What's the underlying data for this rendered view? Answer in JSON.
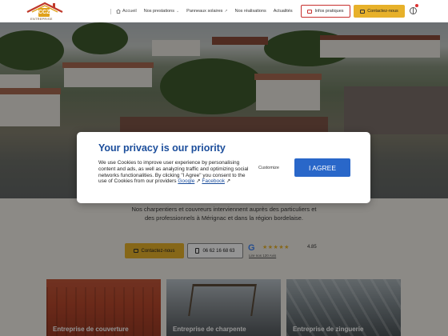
{
  "header": {
    "logo_text": "CCZ",
    "logo_subtext": "ENTREPRISE",
    "nav": [
      {
        "label": "Accueil",
        "icon": "home-icon"
      },
      {
        "label": "Nos prestations",
        "caret": "⌄"
      },
      {
        "label": "Panneaux solaires",
        "ext": "↗"
      },
      {
        "label": "Nos réalisations"
      },
      {
        "label": "Actualités"
      }
    ],
    "infos_label": "Infos pratiques",
    "contact_label": "Contactez-nous"
  },
  "modal": {
    "title": "Your privacy is our priority",
    "body": "We use Cookies to improve user experience by personalising content and ads, as well as analyzing traffic and optimizing social networks functionalities. By clicking \"I Agree\" you consent to the use of Cookies from our providers",
    "google_link": "Google",
    "facebook_link": "Facebook",
    "customize_label": "Customize",
    "agree_label": "I AGREE"
  },
  "hero": {
    "subtitle": "Nos charpentiers et couvreurs interviennent auprès des particuliers et des professionnels à Mérignac et dans la région bordelaise."
  },
  "cta": {
    "contact_label": "Contactez-nous",
    "phone": "06 62 16 68 63"
  },
  "google_rating": {
    "logo": "G",
    "stars": "★★★★★",
    "score": "4.85",
    "reviews": "Lire nos 120 Avis"
  },
  "cards": [
    {
      "label": "Entreprise de couverture"
    },
    {
      "label": "Entreprise de charpente"
    },
    {
      "label": "Entreprise de zinguerie"
    }
  ],
  "colors": {
    "accent": "#e7b12a",
    "modal_title": "#1b4d9b",
    "agree_button": "#2967c9",
    "infos_border": "#c8302f"
  }
}
